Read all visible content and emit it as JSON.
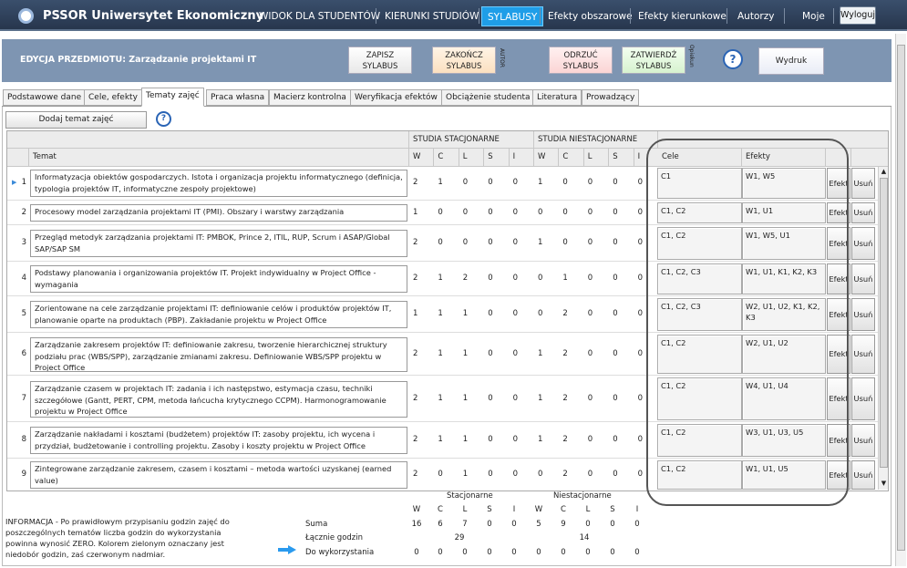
{
  "topnav": {
    "app_name": "PSSOR Uniwersytet Ekonomiczny",
    "items": [
      "WIDOK DLA STUDENTÓW",
      "KIERUNKI STUDIÓW",
      "SYLABUSY",
      "Efekty obszarowe",
      "Efekty kierunkowe",
      "Autorzy",
      "Moje"
    ],
    "active": "SYLABUSY",
    "logout": "Wyloguj"
  },
  "header": {
    "title": "EDYCJA PRZEDMIOTU: Zarządzanie projektami IT",
    "save": "ZAPISZ SYLABUS",
    "finish": "ZAKOŃCZ SYLABUS",
    "author_label": "AUTOR",
    "reject": "ODRZUĆ SYLABUS",
    "approve": "ZATWIERDŹ SYLABUS",
    "guardian_label": "Opiekun",
    "help": "?",
    "print": "Wydruk"
  },
  "tabs": [
    "Podstawowe dane",
    "Cele, efekty",
    "Tematy zajęć",
    "Praca własna",
    "Macierz kontrolna",
    "Weryfikacja efektów",
    "Obciążenie studenta",
    "Literatura",
    "Prowadzący"
  ],
  "active_tab": "Tematy zajęć",
  "toolbar": {
    "add_topic": "Dodaj temat zajęć",
    "help": "?"
  },
  "grid": {
    "headers": {
      "topic": "Temat",
      "stationary": "STUDIA STACJONARNE",
      "nonstationary": "STUDIA NIESTACJONARNE",
      "cols": [
        "W",
        "C",
        "L",
        "S",
        "I"
      ],
      "goals": "Cele",
      "effects": "Efekty"
    },
    "effects_btn": "Efekt",
    "delete_btn": "Usuń",
    "rows": [
      {
        "n": "1",
        "topic": "Informatyzacja obiektów gospodarczych. Istota i organizacja projektu informatycznego (definicja, typologia projektów IT, informatyczne zespoły projektowe)",
        "st": [
          "2",
          "1",
          "0",
          "0",
          "0"
        ],
        "nst": [
          "1",
          "0",
          "0",
          "0",
          "0"
        ],
        "goals": "C1",
        "effects": "W1, W5"
      },
      {
        "n": "2",
        "topic": "Procesowy model zarządzania projektami IT (PMI). Obszary i warstwy zarządzania",
        "st": [
          "1",
          "0",
          "0",
          "0",
          "0"
        ],
        "nst": [
          "0",
          "0",
          "0",
          "0",
          "0"
        ],
        "goals": "C1, C2",
        "effects": "W1, U1"
      },
      {
        "n": "3",
        "topic": "Przegląd metodyk zarządzania projektami IT: PMBOK, Prince 2, ITIL, RUP, Scrum i ASAP/Global SAP/SAP SM",
        "st": [
          "2",
          "0",
          "0",
          "0",
          "0"
        ],
        "nst": [
          "1",
          "0",
          "0",
          "0",
          "0"
        ],
        "goals": "C1, C2",
        "effects": "W1, W5, U1"
      },
      {
        "n": "4",
        "topic": "Podstawy planowania i organizowania projektów IT. Projekt indywidualny w Project Office - wymagania",
        "st": [
          "2",
          "1",
          "2",
          "0",
          "0"
        ],
        "nst": [
          "0",
          "1",
          "0",
          "0",
          "0"
        ],
        "goals": "C1, C2, C3",
        "effects": "W1, U1, K1, K2, K3"
      },
      {
        "n": "5",
        "topic": "Zorientowane na cele zarządzanie projektami IT: definiowanie celów i produktów projektów IT, planowanie oparte na produktach (PBP). Zakładanie projektu w Project Office",
        "st": [
          "1",
          "1",
          "1",
          "0",
          "0"
        ],
        "nst": [
          "0",
          "2",
          "0",
          "0",
          "0"
        ],
        "goals": "C1, C2, C3",
        "effects": "W2, U1, U2, K1, K2, K3"
      },
      {
        "n": "6",
        "topic": "Zarządzanie zakresem projektów IT: definiowanie zakresu, tworzenie hierarchicznej struktury podziału prac (WBS/SPP), zarządzanie zmianami zakresu. Definiowanie WBS/SPP projektu w Project Office",
        "st": [
          "2",
          "1",
          "1",
          "0",
          "0"
        ],
        "nst": [
          "1",
          "2",
          "0",
          "0",
          "0"
        ],
        "goals": "C1, C2",
        "effects": "W2, U1, U2"
      },
      {
        "n": "7",
        "topic": "Zarządzanie czasem w projektach IT: zadania i ich następstwo, estymacja czasu, techniki szczegółowe (Gantt, PERT, CPM, metoda łańcucha krytycznego CCPM). Harmonogramowanie projektu w Project Office",
        "st": [
          "2",
          "1",
          "1",
          "0",
          "0"
        ],
        "nst": [
          "1",
          "2",
          "0",
          "0",
          "0"
        ],
        "goals": "C1, C2",
        "effects": "W4, U1, U4"
      },
      {
        "n": "8",
        "topic": "Zarządzanie nakładami i kosztami (budżetem) projektów IT: zasoby projektu, ich wycena i przydział, budżetowanie i controlling projektu. Zasoby i koszty projektu w Project Office",
        "st": [
          "2",
          "1",
          "1",
          "0",
          "0"
        ],
        "nst": [
          "1",
          "2",
          "0",
          "0",
          "0"
        ],
        "goals": "C1, C2",
        "effects": "W3, U1, U3, U5"
      },
      {
        "n": "9",
        "topic": "Zintegrowane zarządzanie zakresem, czasem i kosztami – metoda wartości uzyskanej (earned value)",
        "st": [
          "2",
          "0",
          "1",
          "0",
          "0"
        ],
        "nst": [
          "0",
          "2",
          "0",
          "0",
          "0"
        ],
        "goals": "C1, C2",
        "effects": "W1, U1, U5"
      }
    ]
  },
  "summary": {
    "info": "INFORMACJA - Po prawidłowym przypisaniu godzin zajęć do poszczególnych tematów liczba godzin do wykorzystania powinna wynosić ZERO. Kolorem zielonym oznaczany jest niedobór godzin, zaś czerwonym nadmiar.",
    "stationary_label": "Stacjonarne",
    "nonstationary_label": "Niestacjonarne",
    "cols": [
      "W",
      "C",
      "L",
      "S",
      "I"
    ],
    "sum_label": "Suma",
    "sum_st": [
      "16",
      "6",
      "7",
      "0",
      "0"
    ],
    "sum_nst": [
      "5",
      "9",
      "0",
      "0",
      "0"
    ],
    "total_label": "Łącznie godzin",
    "total_st": "29",
    "total_nst": "14",
    "remaining_label": "Do wykorzystania",
    "rem_st": [
      "0",
      "0",
      "0",
      "0",
      "0"
    ],
    "rem_nst": [
      "0",
      "0",
      "0",
      "0",
      "0"
    ]
  }
}
